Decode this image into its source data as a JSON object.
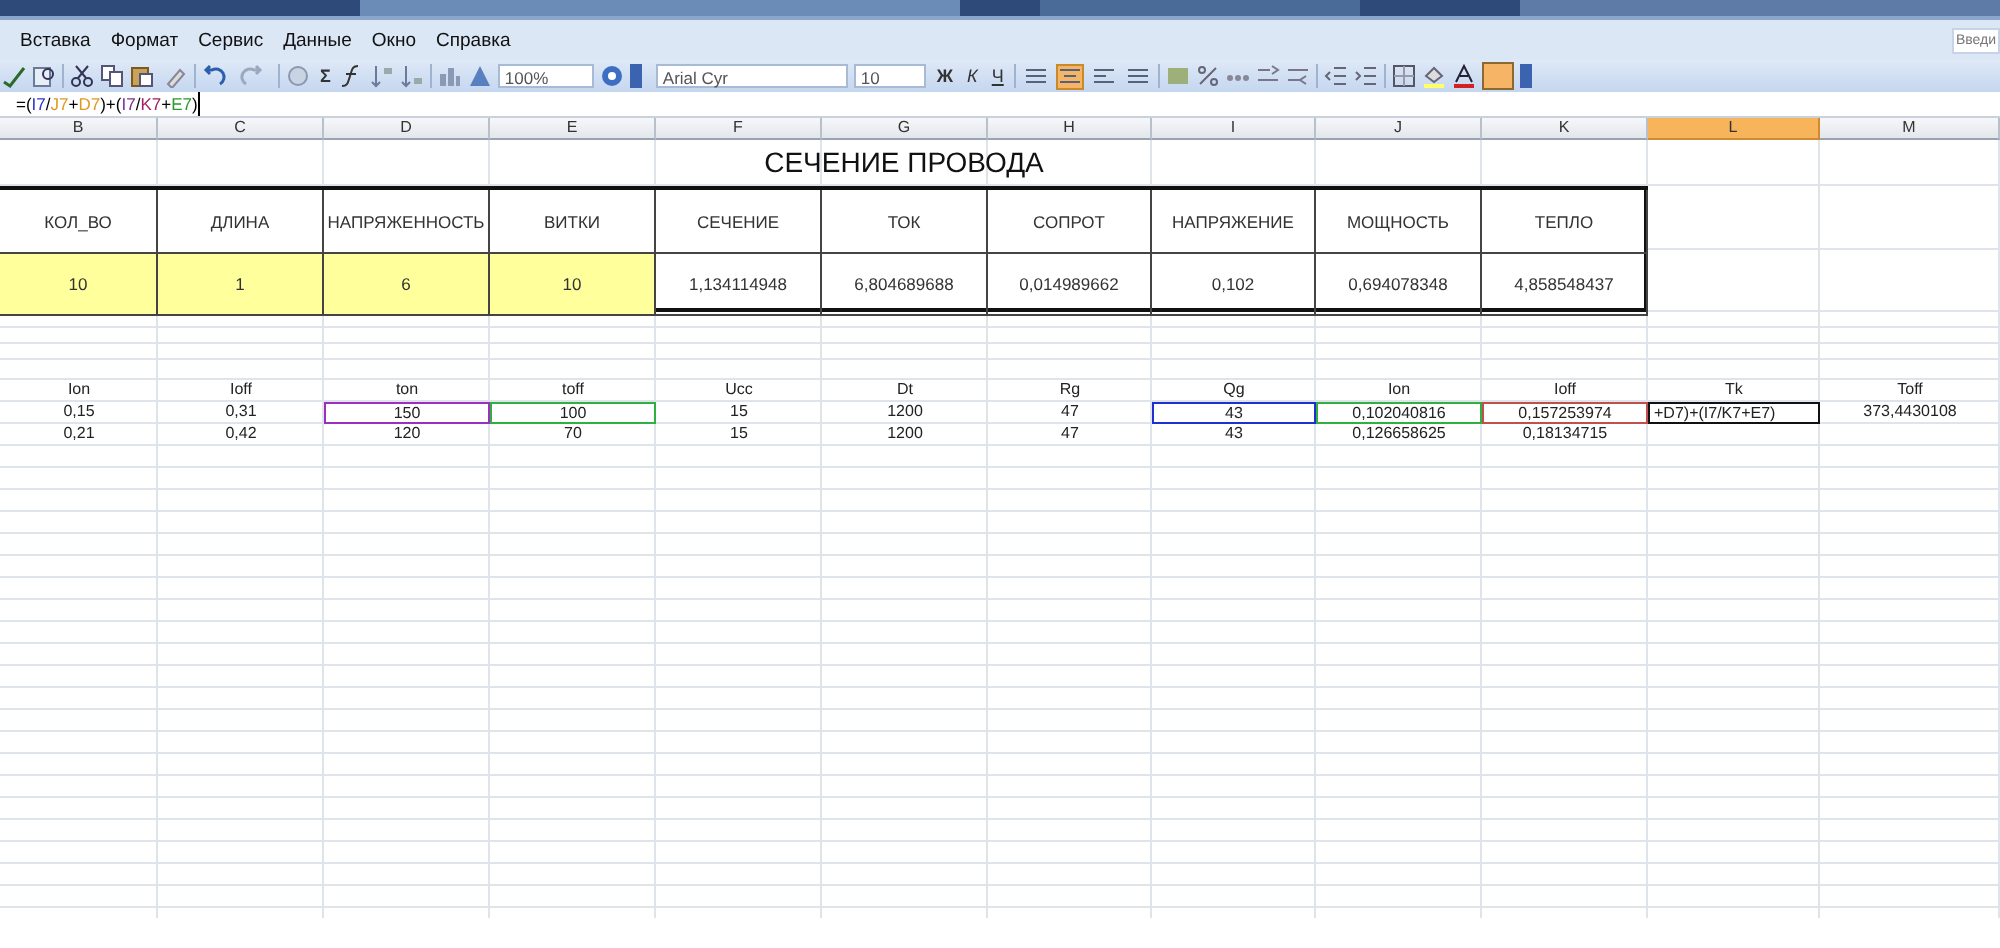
{
  "menu": [
    "Вставка",
    "Формат",
    "Сервис",
    "Данные",
    "Окно",
    "Справка"
  ],
  "help_box": {
    "text": "Введи"
  },
  "toolbar": {
    "sum": "Σ",
    "zoom": "100%",
    "font": "Arial Cyr",
    "size": "10",
    "styles": [
      "Ж",
      "К",
      "Ч"
    ],
    "align": [
      {
        "selected": false
      },
      {
        "selected": true
      },
      {
        "selected": false
      },
      {
        "selected": false
      }
    ]
  },
  "formula": [
    {
      "text": "=(",
      "color": "#000000"
    },
    {
      "text": "I7",
      "color": "#3333cc"
    },
    {
      "text": "/",
      "color": "#000000"
    },
    {
      "text": "J7",
      "color": "#e09a20"
    },
    {
      "text": "+",
      "color": "#000000"
    },
    {
      "text": "D7",
      "color": "#e09a20"
    },
    {
      "text": ")+(",
      "color": "#000000"
    },
    {
      "text": "I7",
      "color": "#7a3090"
    },
    {
      "text": "/",
      "color": "#000000"
    },
    {
      "text": "K7",
      "color": "#a02060"
    },
    {
      "text": "+",
      "color": "#000000"
    },
    {
      "text": "E7",
      "color": "#2a9a2a"
    },
    {
      "text": ")",
      "color": "#000000"
    }
  ],
  "columns": [
    {
      "label": "B",
      "selected": false
    },
    {
      "label": "C",
      "selected": false
    },
    {
      "label": "D",
      "selected": false
    },
    {
      "label": "E",
      "selected": false
    },
    {
      "label": "F",
      "selected": false
    },
    {
      "label": "G",
      "selected": false
    },
    {
      "label": "H",
      "selected": false
    },
    {
      "label": "I",
      "selected": false
    },
    {
      "label": "J",
      "selected": false
    },
    {
      "label": "K",
      "selected": false
    },
    {
      "label": "L",
      "selected": true
    },
    {
      "label": "M",
      "selected": false
    }
  ],
  "title": "СЕЧЕНИЕ ПРОВОДА",
  "summary_headers": [
    "КОЛ_ВО",
    "ДЛИНА",
    "НАПРЯЖЕННОСТЬ",
    "ВИТКИ",
    "СЕЧЕНИЕ",
    "ТОК",
    "СОПРОТ",
    "НАПРЯЖЕНИЕ",
    "МОЩНОСТЬ",
    "ТЕПЛО"
  ],
  "summary_values": [
    {
      "text": "10",
      "input": true
    },
    {
      "text": "1",
      "input": true
    },
    {
      "text": "6",
      "input": true
    },
    {
      "text": "10",
      "input": true
    },
    {
      "text": "1,134114948",
      "input": false
    },
    {
      "text": "6,804689688",
      "input": false
    },
    {
      "text": "0,014989662",
      "input": false
    },
    {
      "text": "0,102",
      "input": false
    },
    {
      "text": "0,694078348",
      "input": false
    },
    {
      "text": "4,858548437",
      "input": false
    }
  ],
  "param_headers": [
    "Ion",
    "Ioff",
    "ton",
    "toff",
    "Ucc",
    "Dt",
    "Rg",
    "Qg",
    "Ion",
    "Ioff",
    "Tk",
    "Toff"
  ],
  "param_rows": [
    [
      {
        "text": "0,15",
        "editing": false
      },
      {
        "text": "0,31",
        "editing": false
      },
      {
        "text": "150",
        "editing": false,
        "color": "#9b30c0"
      },
      {
        "text": "100",
        "editing": false,
        "color": "#30b040"
      },
      {
        "text": "15",
        "editing": false
      },
      {
        "text": "1200",
        "editing": false
      },
      {
        "text": "47",
        "editing": false
      },
      {
        "text": "43",
        "editing": false,
        "color": "#2030d0"
      },
      {
        "text": "0,102040816",
        "editing": false,
        "color": "#30b040"
      },
      {
        "text": "0,157253974",
        "editing": false,
        "color": "#c05050"
      },
      {
        "text": "+D7)+(I7/K7+E7)",
        "editing": true
      },
      {
        "text": "373,4430108",
        "editing": false
      }
    ],
    [
      {
        "text": "0,21"
      },
      {
        "text": "0,42"
      },
      {
        "text": "120"
      },
      {
        "text": "70"
      },
      {
        "text": "15"
      },
      {
        "text": "1200"
      },
      {
        "text": "47"
      },
      {
        "text": "43"
      },
      {
        "text": "0,126658625"
      },
      {
        "text": "0,18134715"
      },
      null,
      null
    ]
  ]
}
